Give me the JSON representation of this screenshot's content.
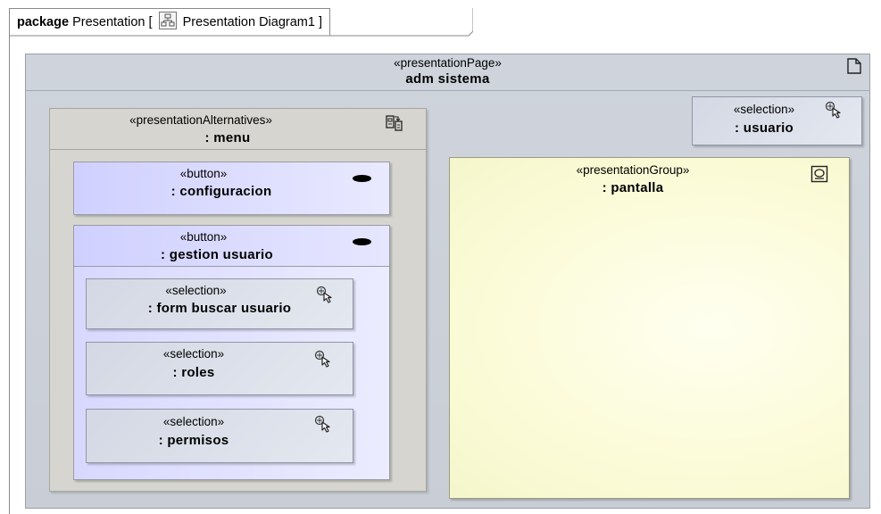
{
  "frame": {
    "keyword": "package",
    "name": "Presentation",
    "bracket_open": "[",
    "diagram_name": "Presentation Diagram1",
    "bracket_close": "]",
    "diagram_icon": "diagram-icon"
  },
  "page": {
    "stereotype": "«presentationPage»",
    "name": "adm sistema",
    "icon": "page-icon"
  },
  "menu": {
    "stereotype": "«presentationAlternatives»",
    "name": ": menu",
    "icon": "alternatives-icon"
  },
  "configuracion": {
    "stereotype": "«button»",
    "name": ": configuracion",
    "icon": "button-icon"
  },
  "gestion_usuario": {
    "stereotype": "«button»",
    "name": ": gestion usuario",
    "icon": "button-icon"
  },
  "form_buscar": {
    "stereotype": "«selection»",
    "name": ": form buscar usuario",
    "icon": "selection-cursor-icon"
  },
  "roles": {
    "stereotype": "«selection»",
    "name": ": roles",
    "icon": "selection-cursor-icon"
  },
  "permisos": {
    "stereotype": "«selection»",
    "name": ": permisos",
    "icon": "selection-cursor-icon"
  },
  "usuario": {
    "stereotype": "«selection»",
    "name": ": usuario",
    "icon": "selection-cursor-icon"
  },
  "pantalla": {
    "stereotype": "«presentationGroup»",
    "name": ": pantalla",
    "icon": "group-icon"
  },
  "colors": {
    "page_fill": "#cfd4dc",
    "alternatives_fill": "#d6d5cf",
    "button_fill": "#d8d8ff",
    "selection_fill": "#d9dde8",
    "group_fill": "#fbfbd8"
  }
}
